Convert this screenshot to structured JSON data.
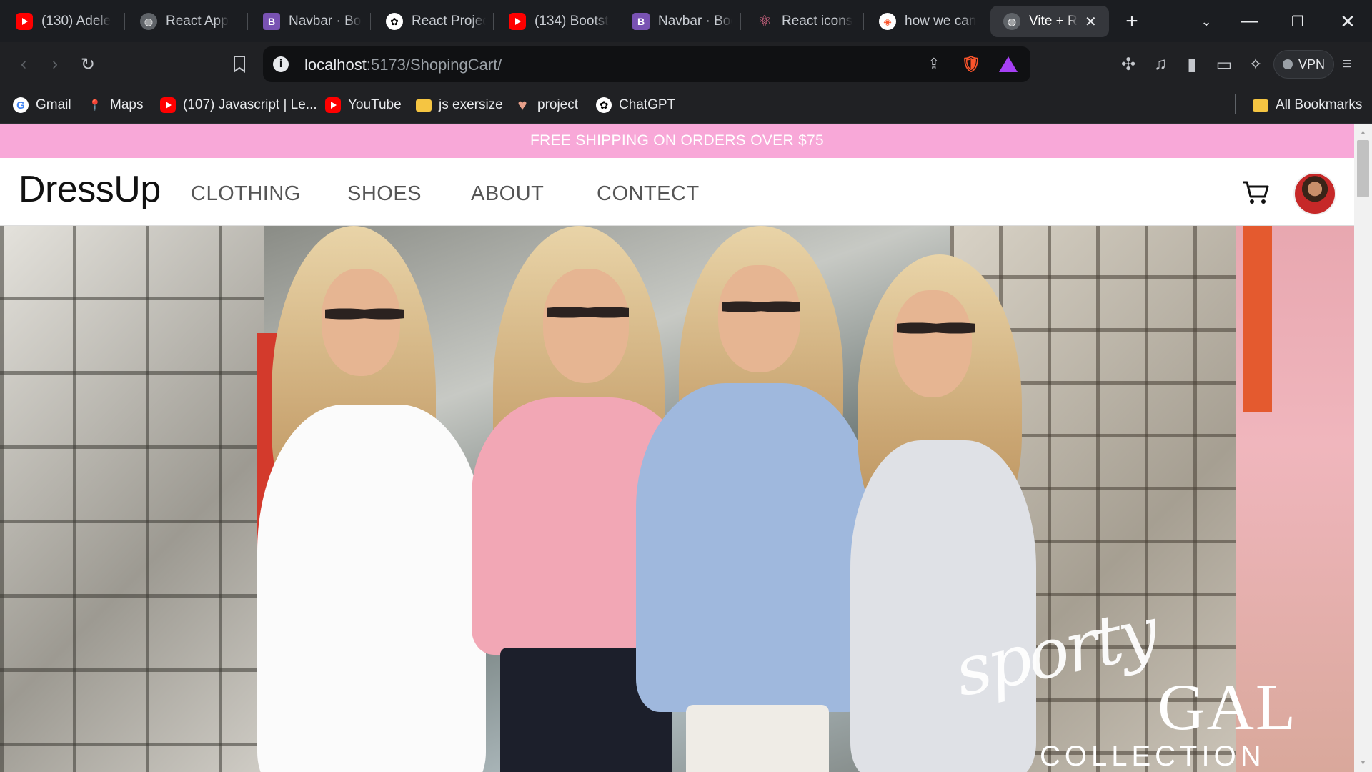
{
  "browser": {
    "tabs": [
      {
        "title": "(130) Adele",
        "favicon": "youtube-icon"
      },
      {
        "title": "React App",
        "favicon": "globe-icon"
      },
      {
        "title": "Navbar · Boo",
        "favicon": "bootstrap-icon"
      },
      {
        "title": "React Projec",
        "favicon": "chatgpt-icon"
      },
      {
        "title": "(134) Bootst",
        "favicon": "youtube-icon"
      },
      {
        "title": "Navbar · Boo",
        "favicon": "bootstrap-icon"
      },
      {
        "title": "React icons",
        "favicon": "react-icon"
      },
      {
        "title": "how we can",
        "favicon": "brave-icon"
      },
      {
        "title": "Vite + R",
        "favicon": "globe-icon",
        "active": true
      }
    ],
    "url_host": "localhost",
    "url_rest": ":5173/ShopingCart/",
    "vpn_label": "VPN",
    "bookmarks": [
      {
        "label": "Gmail",
        "icon": "google-icon"
      },
      {
        "label": "Maps",
        "icon": "maps-icon"
      },
      {
        "label": "(107) Javascript | Le...",
        "icon": "youtube-icon"
      },
      {
        "label": "YouTube",
        "icon": "youtube-icon"
      },
      {
        "label": "js exersize",
        "icon": "folder-icon"
      },
      {
        "label": "project",
        "icon": "heart-icon"
      },
      {
        "label": "ChatGPT",
        "icon": "chatgpt-icon"
      }
    ],
    "all_bookmarks_label": "All Bookmarks"
  },
  "site": {
    "promo_text": "FREE SHIPPING ON ORDERS OVER $75",
    "logo": "DressUp",
    "nav": [
      "CLOTHING",
      "SHOES",
      "ABOUT",
      "CONTECT"
    ],
    "hero": {
      "script_text": "sporty",
      "gal_text": "GAL",
      "collection_text": "COLLECTION"
    }
  },
  "colors": {
    "promo_bg": "#f8a8d8",
    "tab_bg": "#1b1d21",
    "toolbar_bg": "#202124"
  }
}
